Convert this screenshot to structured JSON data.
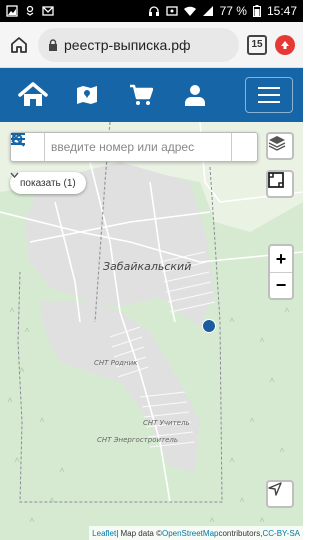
{
  "statusbar": {
    "battery": "77 %",
    "time": "15:47"
  },
  "browser": {
    "url": "реестр-выписка.рф",
    "tab_count": "15"
  },
  "map": {
    "search_placeholder": "введите номер или адрес",
    "show_label": "показать (1)",
    "zoom_in": "+",
    "zoom_out": "−",
    "labels": {
      "town": "Забайкальский",
      "snt1": "СНТ Родник",
      "snt2": "СНТ Учитель",
      "snt3": "СНТ Энергостроитель"
    },
    "attribution": {
      "leaflet": "Leaflet",
      "sep1": " | Map data © ",
      "osm": "OpenStreetMap",
      "contrib": " contributors, ",
      "license": "CC-BY-SA"
    }
  },
  "colors": {
    "nav": "#1565a7",
    "marker": "#1a5c9e",
    "forest": "#d4ead0",
    "urban": "#e0e0e0"
  }
}
